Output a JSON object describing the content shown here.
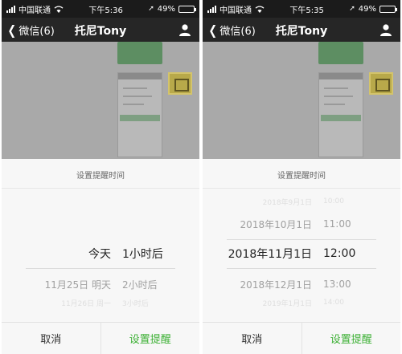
{
  "accent_color": "#3cb034",
  "left": {
    "status": {
      "carrier": "中国联通",
      "time": "下午5:36",
      "battery": "49%",
      "battery_level": 0.49
    },
    "nav": {
      "back_label": "微信(6)",
      "title": "托尼Tony",
      "profile_icon": "person-icon"
    },
    "sheet": {
      "title": "设置提醒时间",
      "rows": [
        {
          "date": "今天",
          "time": "1小时后"
        },
        {
          "date": "11月25日 明天",
          "time": "2小时后"
        },
        {
          "date": "11月26日 周一",
          "time": "3小时后"
        }
      ],
      "cancel": "取消",
      "confirm": "设置提醒"
    }
  },
  "right": {
    "status": {
      "carrier": "中国联通",
      "time": "下午5:35",
      "battery": "49%",
      "battery_level": 0.49
    },
    "nav": {
      "back_label": "微信(6)",
      "title": "托尼Tony",
      "profile_icon": "person-icon"
    },
    "sheet": {
      "title": "设置提醒时间",
      "rows": [
        {
          "date": "2018年9月1日",
          "time": "10:00"
        },
        {
          "date": "2018年10月1日",
          "time": "11:00"
        },
        {
          "date": "2018年11月1日",
          "time": "12:00"
        },
        {
          "date": "2018年12月1日",
          "time": "13:00"
        },
        {
          "date": "2019年1月1日",
          "time": "14:00"
        }
      ],
      "cancel": "取消",
      "confirm": "设置提醒"
    }
  }
}
